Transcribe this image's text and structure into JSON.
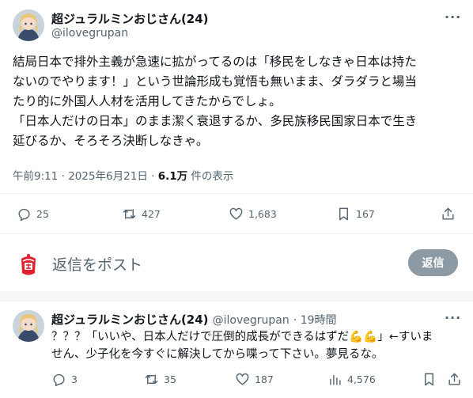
{
  "tweet": {
    "author_name": "超ジュラルミンおじさん(24)",
    "author_handle": "@ilovegrupan",
    "more": "···",
    "lines": [
      "結局日本で排外主義が急速に拡がってるのは「移民をしなきゃ日本は持た",
      "ないのでやります！」という世論形成も覚悟も無いまま、ダラダラと場当",
      "たり的に外国人人材を活用してきたからでしょ。",
      "「日本人だけの日本」のまま潔く衰退するか、多民族移民国家日本で生き",
      "延びるか、そろそろ決断しなきゃ。"
    ],
    "time": "午前9:11 · 2025年6月21日 · ",
    "views_count": "6.1万",
    "views_label": " 件の表示",
    "reply_count": "25",
    "retweet_count": "427",
    "like_count": "1,683",
    "bookmark_count": "167"
  },
  "composer": {
    "placeholder": "返信をポスト",
    "button": "返信"
  },
  "reply": {
    "author_name": "超ジュラルミンおじさん(24)",
    "author_handle": "@ilovegrupan",
    "time": "· 19時間",
    "more": "···",
    "line1_a": "？？？「いいや、日本人だけで圧倒的成長ができるはずだ",
    "line1_emoji": "💪💪",
    "line1_b": "」←すいま",
    "line2": "せん、少子化を今すぐに解決してから喋って下さい。夢見るな。",
    "reply_count": "3",
    "retweet_count": "35",
    "like_count": "187",
    "views_count": "4,576"
  }
}
